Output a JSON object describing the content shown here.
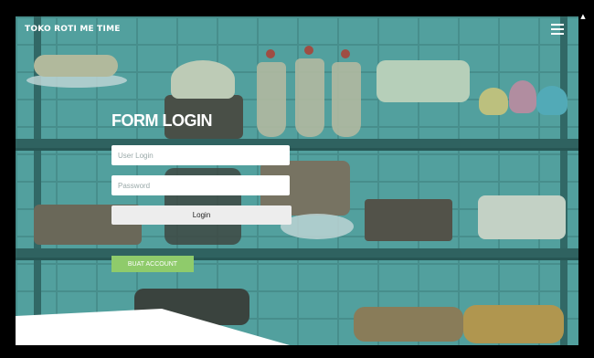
{
  "header": {
    "brand": "TOKO ROTI ME TIME",
    "menu_icon": "hamburger-menu-icon"
  },
  "login_form": {
    "title": "FORM LOGIN",
    "username_placeholder": "User Login",
    "password_placeholder": "Password",
    "login_label": "Login",
    "signup_label": "BUAT ACCOUNT"
  },
  "colors": {
    "background_overlay": "#4f9b9a",
    "signup_button": "#8fcb6b",
    "text_light": "#ffffff"
  },
  "scrollbar": {
    "up_icon": "scroll-up-icon"
  }
}
